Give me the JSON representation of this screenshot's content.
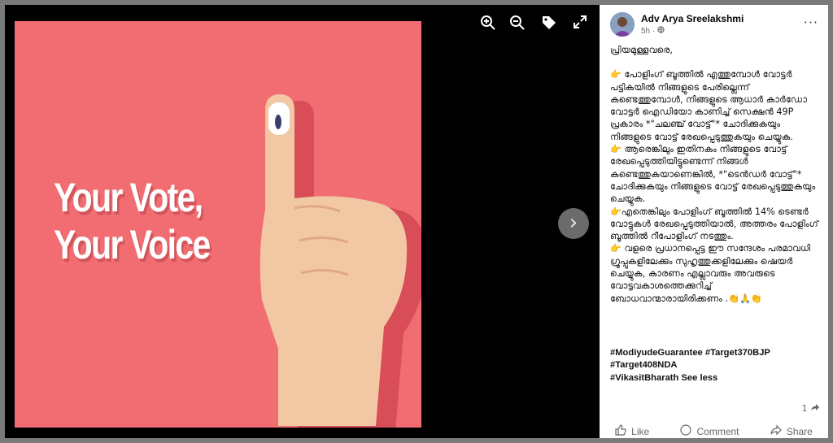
{
  "image": {
    "slogan_line1": "Your Vote,",
    "slogan_line2": "Your Voice",
    "background_color": "#f16d72"
  },
  "viewer_tools": [
    {
      "name": "zoom-in-icon",
      "glyph": "⊕"
    },
    {
      "name": "zoom-out-icon",
      "glyph": "⊖"
    },
    {
      "name": "tag-icon",
      "glyph": "🏷"
    },
    {
      "name": "fullscreen-icon",
      "glyph": "⤢"
    }
  ],
  "next_button": "›",
  "post": {
    "author": "Adv Arya Sreelakshmi",
    "time": "5h ·",
    "more": "···",
    "greeting": "പ്രിയമുള്ളവരെ,",
    "para1": "👉 പോളിംഗ് ബൂത്തിൽ എത്തുമ്പോൾ വോട്ടർ പട്ടികയിൽ നിങ്ങളുടെ പേരില്ലെന്ന് കണ്ടെത്തുമ്പോൾ, നിങ്ങളുടെ ആധാർ കാർഡോ വോട്ടർ ഐഡിയോ കാണിച്ച് സെക്ഷൻ 49P പ്രകാരം *\"ചലഞ്ച് വോട്ട്\"* ചോദിക്കുകയും നിങ്ങളുടെ വോട്ട് രേഖപ്പെടുത്തുകയും ചെയ്യുക.",
    "para2": "👉 ആരെങ്കിലും ഇതിനകം നിങ്ങളുടെ വോട്ട് രേഖപ്പെടുത്തിയിട്ടുണ്ടെന്ന് നിങ്ങൾ കണ്ടെത്തുകയാണെങ്കിൽ, *\"ടെൻഡർ വോട്ട്\"* ചോദിക്കുകയും നിങ്ങളുടെ വോട്ട് രേഖപ്പെടുത്തുകയും ചെയ്യുക.",
    "para3": "👉എതെങ്കിലും പോളിംഗ് ബൂത്തിൽ 14% ടെണ്ടർ വോട്ടുകൾ രേഖപ്പെടുത്തിയാൽ, അത്തരം പോളിംഗ് ബൂത്തിൽ റീപോളിംഗ് നടത്തും.",
    "para4": "👉 വളരെ പ്രധാനപ്പെട്ട ഈ സന്ദേശം പരമാവധി ഗ്രൂപ്പുകളിലേക്കും സുഹൃത്തുക്കളിലേക്കും ഷെയർ ചെയ്യുക, കാരണം എല്ലാവരും അവരുടെ വോട്ടവകാശത്തെക്കുറിച്ച് ബോധവാന്മാരായിരിക്കണം .👏🙏👏",
    "hashtags_line1": "#ModiyudeGuarantee #Target370BJP",
    "hashtags_line2": "#Target408NDA",
    "hashtags_line3": "#VikasitBharath See less",
    "share_count": "1",
    "like_label": "Like",
    "comment_label": "Comment",
    "share_label": "Share"
  }
}
